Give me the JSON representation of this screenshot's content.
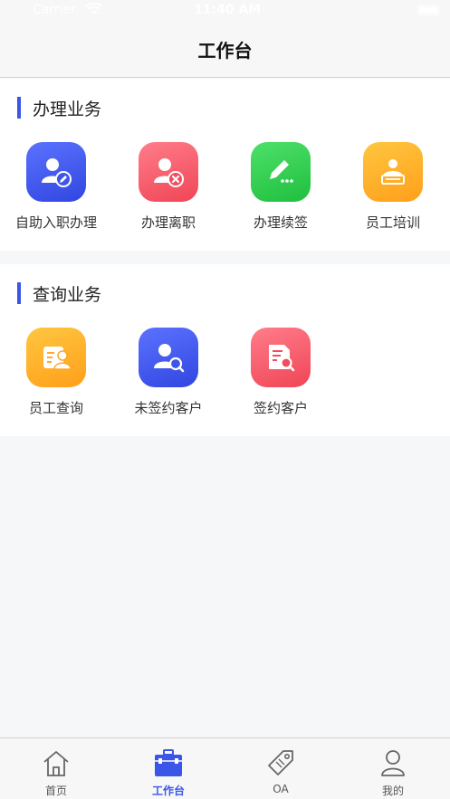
{
  "status_bar": {
    "carrier": "Carrier",
    "time": "11:40 AM"
  },
  "nav": {
    "title": "工作台"
  },
  "sections": [
    {
      "title": "办理业务",
      "items": [
        {
          "label": "自助入职办理",
          "icon": "user-edit-icon",
          "color": "#4a5ff2"
        },
        {
          "label": "办理离职",
          "icon": "user-remove-icon",
          "color": "#f5586a"
        },
        {
          "label": "办理续签",
          "icon": "pencil-icon",
          "color": "#2fcf4f"
        },
        {
          "label": "员工培训",
          "icon": "training-icon",
          "color": "#ffb22e"
        }
      ]
    },
    {
      "title": "查询业务",
      "items": [
        {
          "label": "员工查询",
          "icon": "employee-card-icon",
          "color": "#ffb22e"
        },
        {
          "label": "未签约客户",
          "icon": "user-search-icon",
          "color": "#4a5ff2"
        },
        {
          "label": "签约客户",
          "icon": "document-search-icon",
          "color": "#f5586a"
        }
      ]
    }
  ],
  "tab_bar": {
    "active_color": "#3a55e8",
    "tabs": [
      {
        "label": "首页",
        "icon": "home-icon",
        "active": false
      },
      {
        "label": "工作台",
        "icon": "briefcase-icon",
        "active": true
      },
      {
        "label": "OA",
        "icon": "tag-icon",
        "active": false
      },
      {
        "label": "我的",
        "icon": "person-icon",
        "active": false
      }
    ]
  }
}
